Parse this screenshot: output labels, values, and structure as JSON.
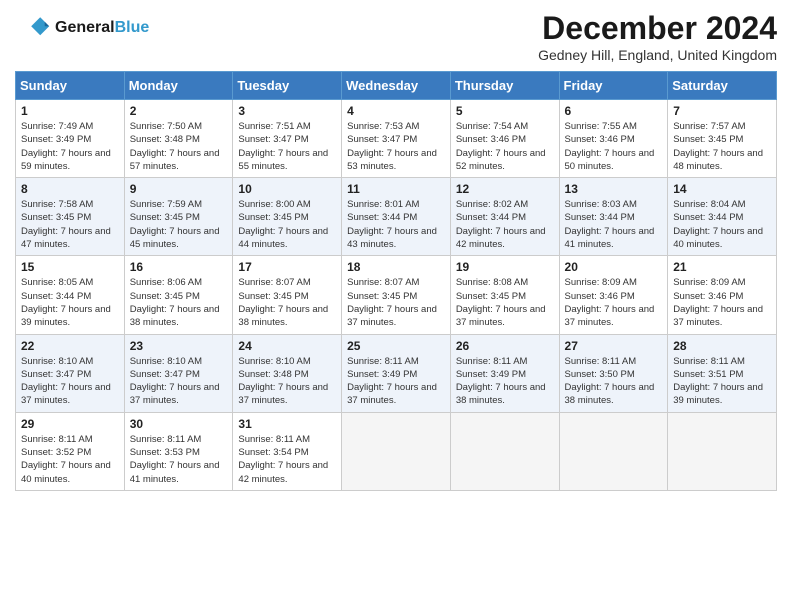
{
  "header": {
    "logo_text_general": "General",
    "logo_text_blue": "Blue",
    "title": "December 2024",
    "location": "Gedney Hill, England, United Kingdom"
  },
  "days_of_week": [
    "Sunday",
    "Monday",
    "Tuesday",
    "Wednesday",
    "Thursday",
    "Friday",
    "Saturday"
  ],
  "weeks": [
    [
      {
        "day": 1,
        "sunrise": "7:49 AM",
        "sunset": "3:49 PM",
        "daylight": "7 hours and 59 minutes."
      },
      {
        "day": 2,
        "sunrise": "7:50 AM",
        "sunset": "3:48 PM",
        "daylight": "7 hours and 57 minutes."
      },
      {
        "day": 3,
        "sunrise": "7:51 AM",
        "sunset": "3:47 PM",
        "daylight": "7 hours and 55 minutes."
      },
      {
        "day": 4,
        "sunrise": "7:53 AM",
        "sunset": "3:47 PM",
        "daylight": "7 hours and 53 minutes."
      },
      {
        "day": 5,
        "sunrise": "7:54 AM",
        "sunset": "3:46 PM",
        "daylight": "7 hours and 52 minutes."
      },
      {
        "day": 6,
        "sunrise": "7:55 AM",
        "sunset": "3:46 PM",
        "daylight": "7 hours and 50 minutes."
      },
      {
        "day": 7,
        "sunrise": "7:57 AM",
        "sunset": "3:45 PM",
        "daylight": "7 hours and 48 minutes."
      }
    ],
    [
      {
        "day": 8,
        "sunrise": "7:58 AM",
        "sunset": "3:45 PM",
        "daylight": "7 hours and 47 minutes."
      },
      {
        "day": 9,
        "sunrise": "7:59 AM",
        "sunset": "3:45 PM",
        "daylight": "7 hours and 45 minutes."
      },
      {
        "day": 10,
        "sunrise": "8:00 AM",
        "sunset": "3:45 PM",
        "daylight": "7 hours and 44 minutes."
      },
      {
        "day": 11,
        "sunrise": "8:01 AM",
        "sunset": "3:44 PM",
        "daylight": "7 hours and 43 minutes."
      },
      {
        "day": 12,
        "sunrise": "8:02 AM",
        "sunset": "3:44 PM",
        "daylight": "7 hours and 42 minutes."
      },
      {
        "day": 13,
        "sunrise": "8:03 AM",
        "sunset": "3:44 PM",
        "daylight": "7 hours and 41 minutes."
      },
      {
        "day": 14,
        "sunrise": "8:04 AM",
        "sunset": "3:44 PM",
        "daylight": "7 hours and 40 minutes."
      }
    ],
    [
      {
        "day": 15,
        "sunrise": "8:05 AM",
        "sunset": "3:44 PM",
        "daylight": "7 hours and 39 minutes."
      },
      {
        "day": 16,
        "sunrise": "8:06 AM",
        "sunset": "3:45 PM",
        "daylight": "7 hours and 38 minutes."
      },
      {
        "day": 17,
        "sunrise": "8:07 AM",
        "sunset": "3:45 PM",
        "daylight": "7 hours and 38 minutes."
      },
      {
        "day": 18,
        "sunrise": "8:07 AM",
        "sunset": "3:45 PM",
        "daylight": "7 hours and 37 minutes."
      },
      {
        "day": 19,
        "sunrise": "8:08 AM",
        "sunset": "3:45 PM",
        "daylight": "7 hours and 37 minutes."
      },
      {
        "day": 20,
        "sunrise": "8:09 AM",
        "sunset": "3:46 PM",
        "daylight": "7 hours and 37 minutes."
      },
      {
        "day": 21,
        "sunrise": "8:09 AM",
        "sunset": "3:46 PM",
        "daylight": "7 hours and 37 minutes."
      }
    ],
    [
      {
        "day": 22,
        "sunrise": "8:10 AM",
        "sunset": "3:47 PM",
        "daylight": "7 hours and 37 minutes."
      },
      {
        "day": 23,
        "sunrise": "8:10 AM",
        "sunset": "3:47 PM",
        "daylight": "7 hours and 37 minutes."
      },
      {
        "day": 24,
        "sunrise": "8:10 AM",
        "sunset": "3:48 PM",
        "daylight": "7 hours and 37 minutes."
      },
      {
        "day": 25,
        "sunrise": "8:11 AM",
        "sunset": "3:49 PM",
        "daylight": "7 hours and 37 minutes."
      },
      {
        "day": 26,
        "sunrise": "8:11 AM",
        "sunset": "3:49 PM",
        "daylight": "7 hours and 38 minutes."
      },
      {
        "day": 27,
        "sunrise": "8:11 AM",
        "sunset": "3:50 PM",
        "daylight": "7 hours and 38 minutes."
      },
      {
        "day": 28,
        "sunrise": "8:11 AM",
        "sunset": "3:51 PM",
        "daylight": "7 hours and 39 minutes."
      }
    ],
    [
      {
        "day": 29,
        "sunrise": "8:11 AM",
        "sunset": "3:52 PM",
        "daylight": "7 hours and 40 minutes."
      },
      {
        "day": 30,
        "sunrise": "8:11 AM",
        "sunset": "3:53 PM",
        "daylight": "7 hours and 41 minutes."
      },
      {
        "day": 31,
        "sunrise": "8:11 AM",
        "sunset": "3:54 PM",
        "daylight": "7 hours and 42 minutes."
      },
      null,
      null,
      null,
      null
    ]
  ]
}
